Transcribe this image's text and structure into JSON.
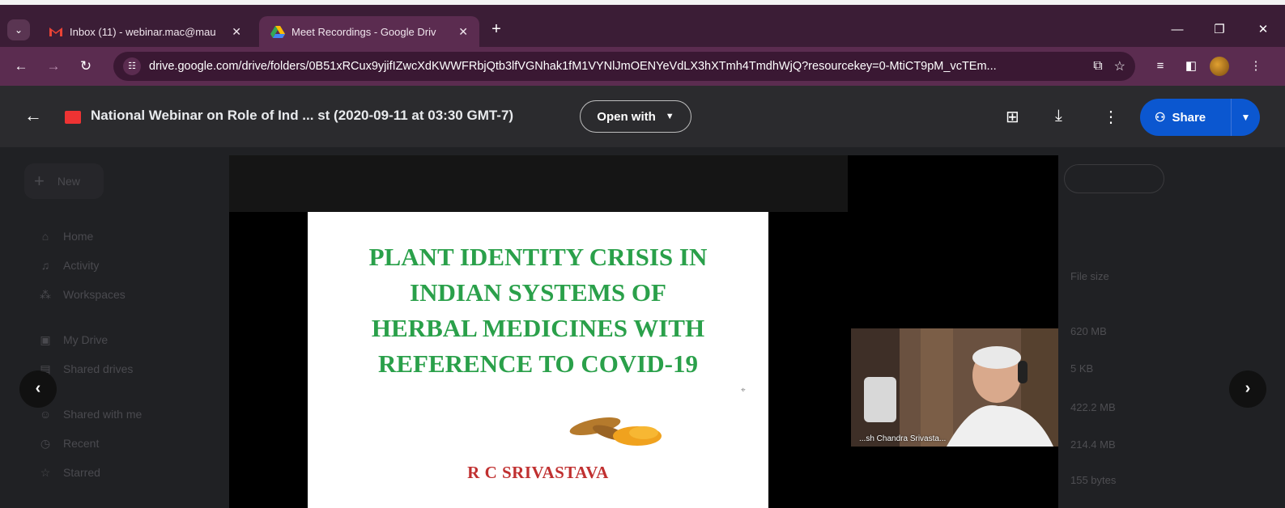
{
  "browser": {
    "tabs": [
      {
        "title": "Inbox (11) - webinar.mac@mau",
        "active": false,
        "icon": "gmail-icon"
      },
      {
        "title": "Meet Recordings - Google Driv",
        "active": true,
        "icon": "google-drive-icon"
      }
    ],
    "url": "drive.google.com/drive/folders/0B51xRCux9yjifIZwcXdKWWFRbjQtb3lfVGNhak1fM1VYNlJmOENYeVdLX3hXTmh4TmdhWjQ?resourcekey=0-MtiCT9pM_vcTEm..."
  },
  "viewer": {
    "file_title": "National Webinar on Role of Ind ... st (2020-09-11 at 03:30 GMT-7)",
    "open_with_label": "Open with",
    "share_label": "Share"
  },
  "drive_background": {
    "new_label": "New",
    "sidebar": [
      "Home",
      "Activity",
      "Workspaces",
      "My Drive",
      "Shared drives",
      "Shared with me",
      "Recent",
      "Starred"
    ],
    "column_header": "File size",
    "sizes": [
      "620 MB",
      "5 KB",
      "422.2 MB",
      "214.4 MB",
      "155 bytes"
    ]
  },
  "slide": {
    "title_lines": [
      "PLANT IDENTITY CRISIS IN",
      "INDIAN SYSTEMS OF",
      "HERBAL MEDICINES WITH",
      "REFERENCE TO COVID-19"
    ],
    "author": "R C SRIVASTAVA"
  },
  "participant": {
    "name": "...sh Chandra Srivasta..."
  },
  "colors": {
    "tabbar": "#3b1d36",
    "toolbar": "#5b2c50",
    "share_button": "#0b57d0",
    "slide_title": "#2aa04a",
    "slide_author": "#c03030"
  }
}
